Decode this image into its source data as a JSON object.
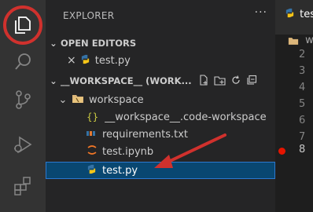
{
  "explorer": {
    "title": "EXPLORER",
    "more": "···",
    "open_editors": {
      "header": "OPEN EDITORS",
      "items": [
        {
          "close": "×",
          "name": "test.py"
        }
      ]
    },
    "workspace": {
      "header": "__WORKSPACE__ (WORK...",
      "folder": "workspace",
      "files": [
        {
          "icon": "{}",
          "name": "__workspace__.code-workspace"
        },
        {
          "name": "requirements.txt"
        },
        {
          "name": "test.ipynb"
        },
        {
          "name": "test.py"
        }
      ]
    }
  },
  "editor": {
    "tab": "tes",
    "breadcrumb": "w",
    "line_numbers": [
      "2",
      "3",
      "4",
      "5",
      "6",
      "7",
      "8"
    ],
    "breakpoint_line": "8"
  },
  "colors": {
    "activity_bar": "#333333",
    "sidebar": "#252526",
    "selection": "#094771",
    "breakpoint": "#e51400",
    "highlight_circle": "#d0312d",
    "arrow": "#d0312d"
  }
}
